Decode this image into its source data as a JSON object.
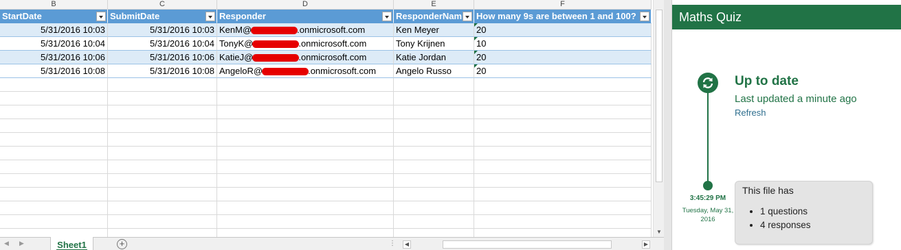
{
  "sheet": {
    "columns": [
      {
        "letter": "B",
        "header": "StartDate"
      },
      {
        "letter": "C",
        "header": "SubmitDate"
      },
      {
        "letter": "D",
        "header": "Responder"
      },
      {
        "letter": "E",
        "header": "ResponderNam"
      },
      {
        "letter": "F",
        "header": "How many 9s are between 1 and 100?"
      }
    ],
    "rows": [
      {
        "start": "5/31/2016 10:03",
        "submit": "5/31/2016 10:03",
        "email_prefix": "KenM@",
        "email_suffix": ".onmicrosoft.com",
        "name": "Ken Meyer",
        "answer": "20"
      },
      {
        "start": "5/31/2016 10:04",
        "submit": "5/31/2016 10:04",
        "email_prefix": "TonyK@",
        "email_suffix": ".onmicrosoft.com",
        "name": "Tony Krijnen",
        "answer": "10"
      },
      {
        "start": "5/31/2016 10:06",
        "submit": "5/31/2016 10:06",
        "email_prefix": "KatieJ@",
        "email_suffix": ".onmicrosoft.com",
        "name": "Katie Jordan",
        "answer": "20"
      },
      {
        "start": "5/31/2016 10:08",
        "submit": "5/31/2016 10:08",
        "email_prefix": "AngeloR@",
        "email_suffix": ".onmicrosoft.com",
        "name": "Angelo Russo",
        "answer": "20"
      }
    ],
    "tab_label": "Sheet1",
    "add_sheet_symbol": "+",
    "colors": {
      "accent": "#217346",
      "header_blue": "#5b9bd5",
      "band_blue": "#ddebf7",
      "redaction": "#e60000"
    }
  },
  "pane": {
    "title": "Maths Quiz",
    "status_title": "Up to date",
    "status_sub": "Last updated a minute ago",
    "refresh_label": "Refresh",
    "time": "3:45:29 PM",
    "date": "Tuesday, May 31, 2016",
    "card_title": "This file has",
    "card_items": [
      "1 questions",
      "4 responses"
    ]
  }
}
